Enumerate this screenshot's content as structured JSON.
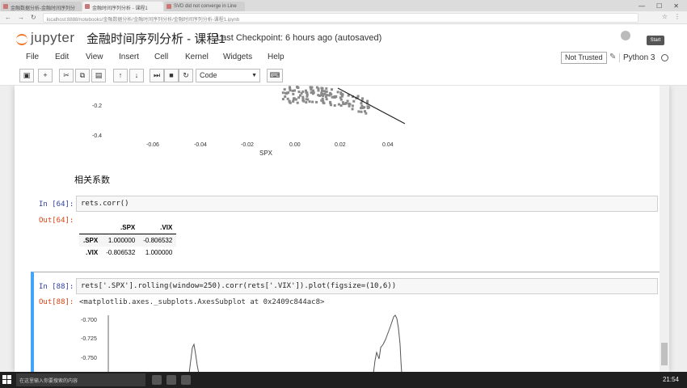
{
  "browser": {
    "tabs": [
      {
        "label": "金融数据分析-金融时间序列分"
      },
      {
        "label": "金融时间序列分析 - 课程1"
      },
      {
        "label": "SVD did not converge in Line"
      }
    ],
    "address": "localhost:8888/notebooks/金融数据分析/金融时间序列分析/金融时间序列分析-课程1.ipynb"
  },
  "jupyter": {
    "logo_text": "jupyter",
    "notebook_title": "金融时间序列分析 - 课程1",
    "checkpoint": "Last Checkpoint: 6 hours ago (autosaved)",
    "logout_label": "Start"
  },
  "menu": {
    "items": [
      "File",
      "Edit",
      "View",
      "Insert",
      "Cell",
      "Kernel",
      "Widgets",
      "Help"
    ],
    "trust_label": "Not Trusted",
    "kernel_name": "Python 3"
  },
  "toolbar": {
    "cell_type": "Code"
  },
  "plot1": {
    "xlabel": "SPX",
    "x_ticks": [
      "-0.06",
      "-0.04",
      "-0.02",
      "0.00",
      "0.02",
      "0.04"
    ],
    "y_ticks": [
      "-0.2",
      "-0.4"
    ]
  },
  "markdown": {
    "heading": "相关系数"
  },
  "cell_64": {
    "in_prompt": "In [64]:",
    "code": "rets.corr()",
    "out_prompt": "Out[64]:"
  },
  "corr_table": {
    "columns": [
      ".SPX",
      ".VIX"
    ],
    "rows": [
      {
        "index": ".SPX",
        "values": [
          "1.000000",
          "-0.806532"
        ]
      },
      {
        "index": ".VIX",
        "values": [
          "-0.806532",
          "1.000000"
        ]
      }
    ]
  },
  "cell_88": {
    "in_prompt": "In [88]:",
    "code": "rets['.SPX'].rolling(window=250).corr(rets['.VIX']).plot(figsize=(10,6))",
    "out_prompt": "Out[88]:",
    "output": "<matplotlib.axes._subplots.AxesSubplot at 0x2409c844ac8>"
  },
  "plot2": {
    "y_ticks": [
      "-0.700",
      "-0.725",
      "-0.750"
    ]
  },
  "taskbar": {
    "search_text": "在这里输入你要搜索的内容",
    "clock": "21:54"
  }
}
